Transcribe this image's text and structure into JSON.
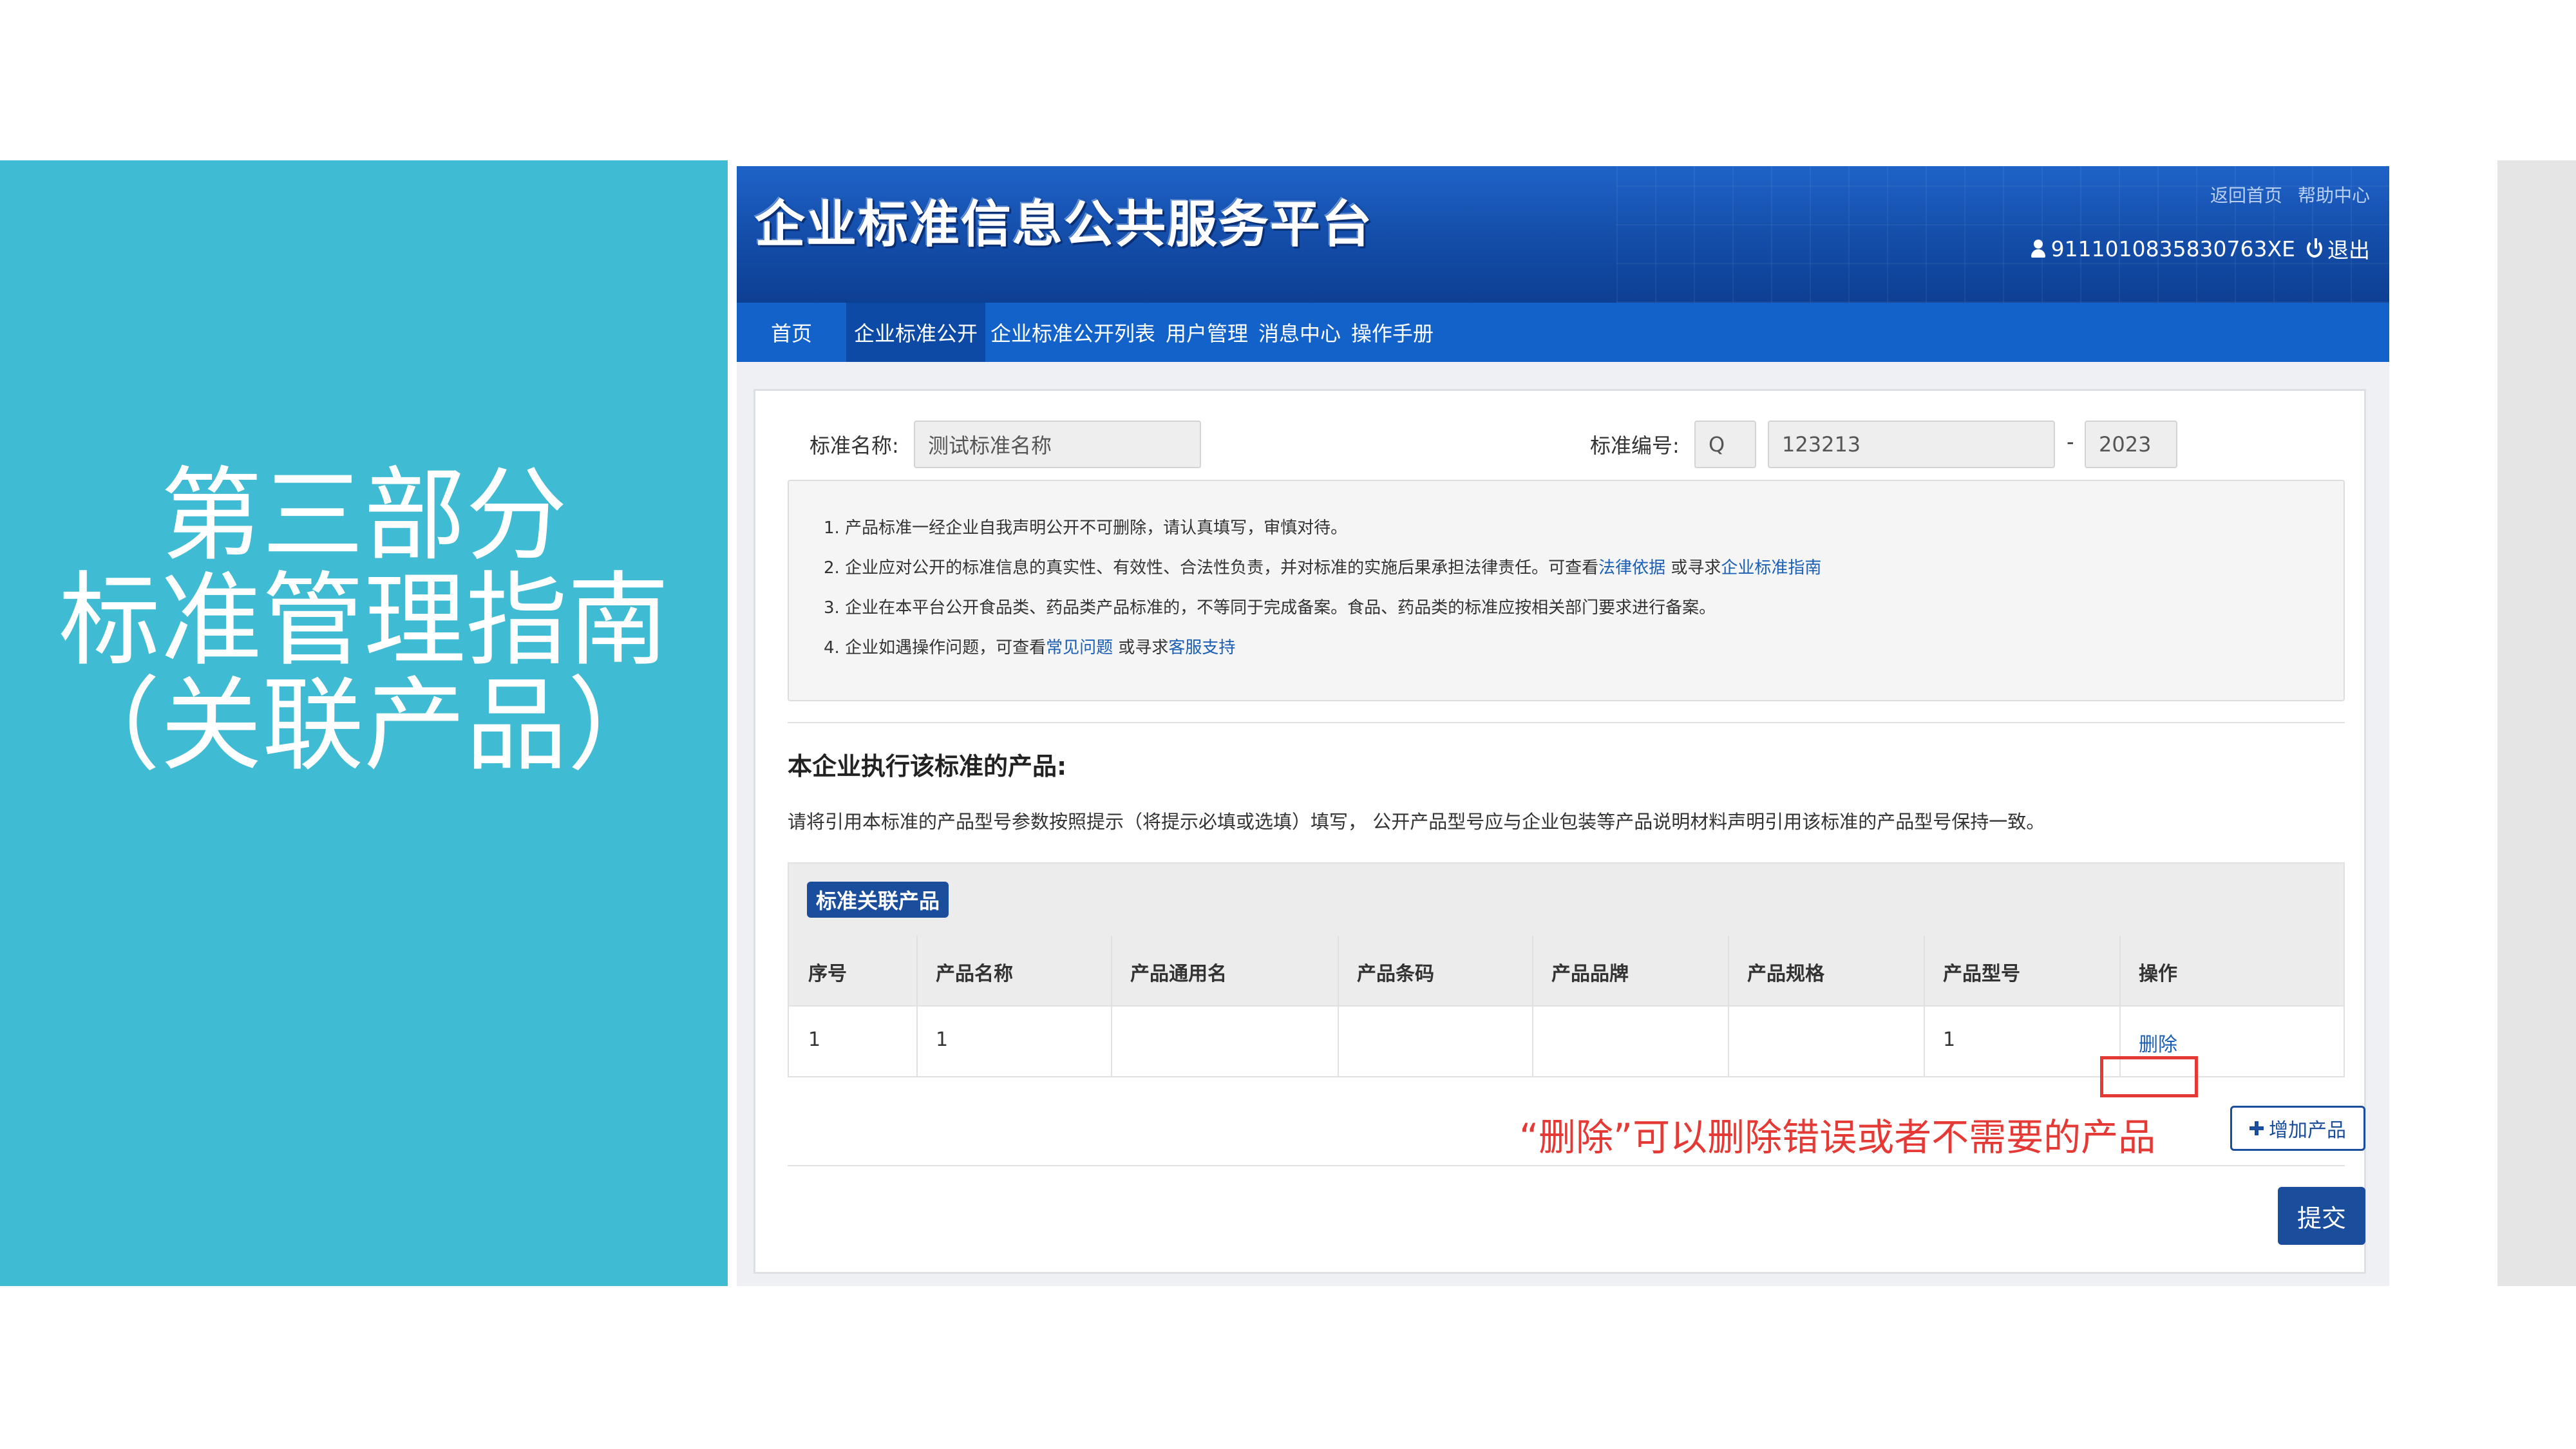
{
  "slide": {
    "title_lines": [
      "第三部分",
      "标准管理指南",
      "（关联产品）"
    ]
  },
  "header": {
    "logo_text": "企业标准信息公共服务平台",
    "links": {
      "home": "返回首页",
      "help": "帮助中心"
    },
    "user_id": "9111010835830763XE",
    "logout": "退出"
  },
  "nav": {
    "items": [
      "首页",
      "企业标准公开",
      "企业标准公开列表",
      "用户管理",
      "消息中心",
      "操作手册"
    ],
    "active_index": 1
  },
  "form": {
    "name_label": "标准名称:",
    "name_value": "测试标准名称",
    "code_label": "标准编号:",
    "code_prefix": "Q",
    "code_number": "123213",
    "code_separator": "-",
    "code_year": "2023"
  },
  "notice": {
    "line1": "1. 产品标准一经企业自我声明公开不可删除，请认真填写，审慎对待。",
    "line2_text": "2. 企业应对公开的标准信息的真实性、有效性、合法性负责，并对标准的实施后果承担法律责任。可查看",
    "line2_link1": "法律依据",
    "line2_mid": "或寻求",
    "line2_link2": "企业标准指南",
    "line3": "3. 企业在本平台公开食品类、药品类产品标准的，不等同于完成备案。食品、药品类的标准应按相关部门要求进行备案。",
    "line4_text": "4. 企业如遇操作问题，可查看",
    "line4_link1": "常见问题",
    "line4_mid": "或寻求",
    "line4_link2": "客服支持"
  },
  "products_section": {
    "title": "本企业执行该标准的产品:",
    "description": "请将引用本标准的产品型号参数按照提示（将提示必填或选填）填写， 公开产品型号应与企业包装等产品说明材料声明引用该标准的产品型号保持一致。",
    "table_badge": "标准关联产品",
    "columns": [
      "序号",
      "产品名称",
      "产品通用名",
      "产品条码",
      "产品品牌",
      "产品规格",
      "产品型号",
      "操作"
    ],
    "rows": [
      {
        "index": "1",
        "name": "1",
        "common_name": "",
        "barcode": "",
        "brand": "",
        "spec": "",
        "model": "1",
        "action": "删除"
      }
    ]
  },
  "annotation": "“删除”可以删除错误或者不需要的产品",
  "buttons": {
    "add_product": "增加产品",
    "submit": "提交"
  },
  "colors": {
    "slide_accent": "#3fbbd3",
    "header_blue": "#1262c9",
    "button_blue": "#1a4d9c",
    "annotation_red": "#e53935"
  }
}
